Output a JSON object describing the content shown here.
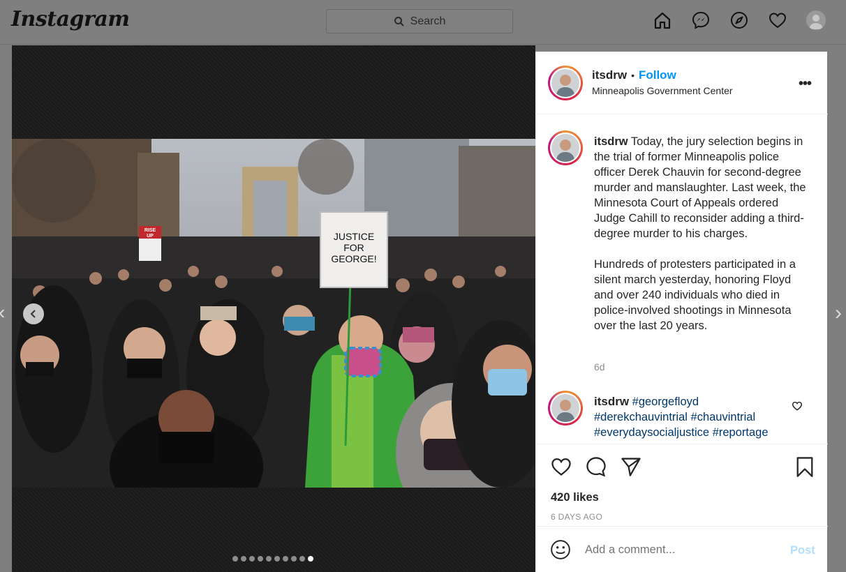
{
  "topbar": {
    "logo_text": "Instagram",
    "search_placeholder": "Search",
    "icons": [
      "home-icon",
      "messenger-icon",
      "explore-icon",
      "activity-heart-icon",
      "profile-avatar"
    ]
  },
  "post": {
    "username": "itsdrw",
    "follow_label": "Follow",
    "separator": "•",
    "location": "Minneapolis Government Center",
    "more_label": "•••",
    "caption_p1": "Today, the jury selection begins in the trial of former Minneapolis police officer Derek Chauvin for second-degree murder and manslaughter. Last week, the Minnesota Court of Appeals ordered Judge Cahill to reconsider adding a third-degree murder to his charges.",
    "caption_p2": "Hundreds of protesters participated in a silent march yesterday, honoring Floyd and over 240 individuals who died in police-involved shootings in Minnesota over the last 20 years.",
    "caption_time": "6d",
    "comment": {
      "username": "itsdrw",
      "hashtags": [
        "#georgefloyd",
        "#derekchauvintrial",
        "#chauvintrial",
        "#everydaysocialjustice",
        "#reportage"
      ]
    },
    "likes_label": "420 likes",
    "posted_ago": "6 DAYS AGO",
    "comment_placeholder": "Add a comment...",
    "post_label": "Post",
    "carousel_total": 10,
    "carousel_active": 10
  },
  "photo": {
    "sign_text_lines": [
      "JUSTICE",
      "FOR",
      "GEORGE!"
    ],
    "sign_left_text_lines": [
      "RISE",
      "UP"
    ]
  },
  "colors": {
    "accent_blue": "#0095f6",
    "hashtag": "#00376b",
    "muted": "#8e8e8e"
  }
}
